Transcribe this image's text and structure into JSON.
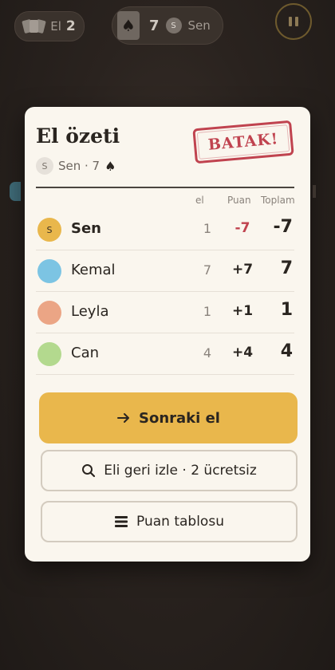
{
  "topbar": {
    "hand_label": "El",
    "hand_number": "2",
    "bid_number": "7",
    "bid_player_initial": "S",
    "bid_player_name": "Sen"
  },
  "modal": {
    "title": "El özeti",
    "bidder_initial": "S",
    "bidder_summary": "Sen · 7",
    "stamp_text": "BATAK!",
    "columns": {
      "el": "el",
      "puan": "Puan",
      "toplam": "Toplam"
    },
    "rows": [
      {
        "initial": "S",
        "name": "Sen",
        "el": "1",
        "puan": "-7",
        "toplam": "-7",
        "color": "#e9b74c"
      },
      {
        "initial": "",
        "name": "Kemal",
        "el": "7",
        "puan": "+7",
        "toplam": "7",
        "color": "#7cc4e3"
      },
      {
        "initial": "",
        "name": "Leyla",
        "el": "1",
        "puan": "+1",
        "toplam": "1",
        "color": "#eba585"
      },
      {
        "initial": "",
        "name": "Can",
        "el": "4",
        "puan": "+4",
        "toplam": "4",
        "color": "#b3d98e"
      }
    ],
    "next_button": "Sonraki el",
    "replay_button": "Eli geri izle · 2 ücretsiz",
    "scoreboard_button": "Puan tablosu"
  },
  "colors": {
    "accent": "#e9b74c",
    "danger": "#c0434f",
    "card_bg": "#faf6ee"
  },
  "icons": [
    "cards-icon",
    "spade-icon",
    "pause-icon",
    "arrow-right-icon",
    "search-icon",
    "menu-icon"
  ]
}
